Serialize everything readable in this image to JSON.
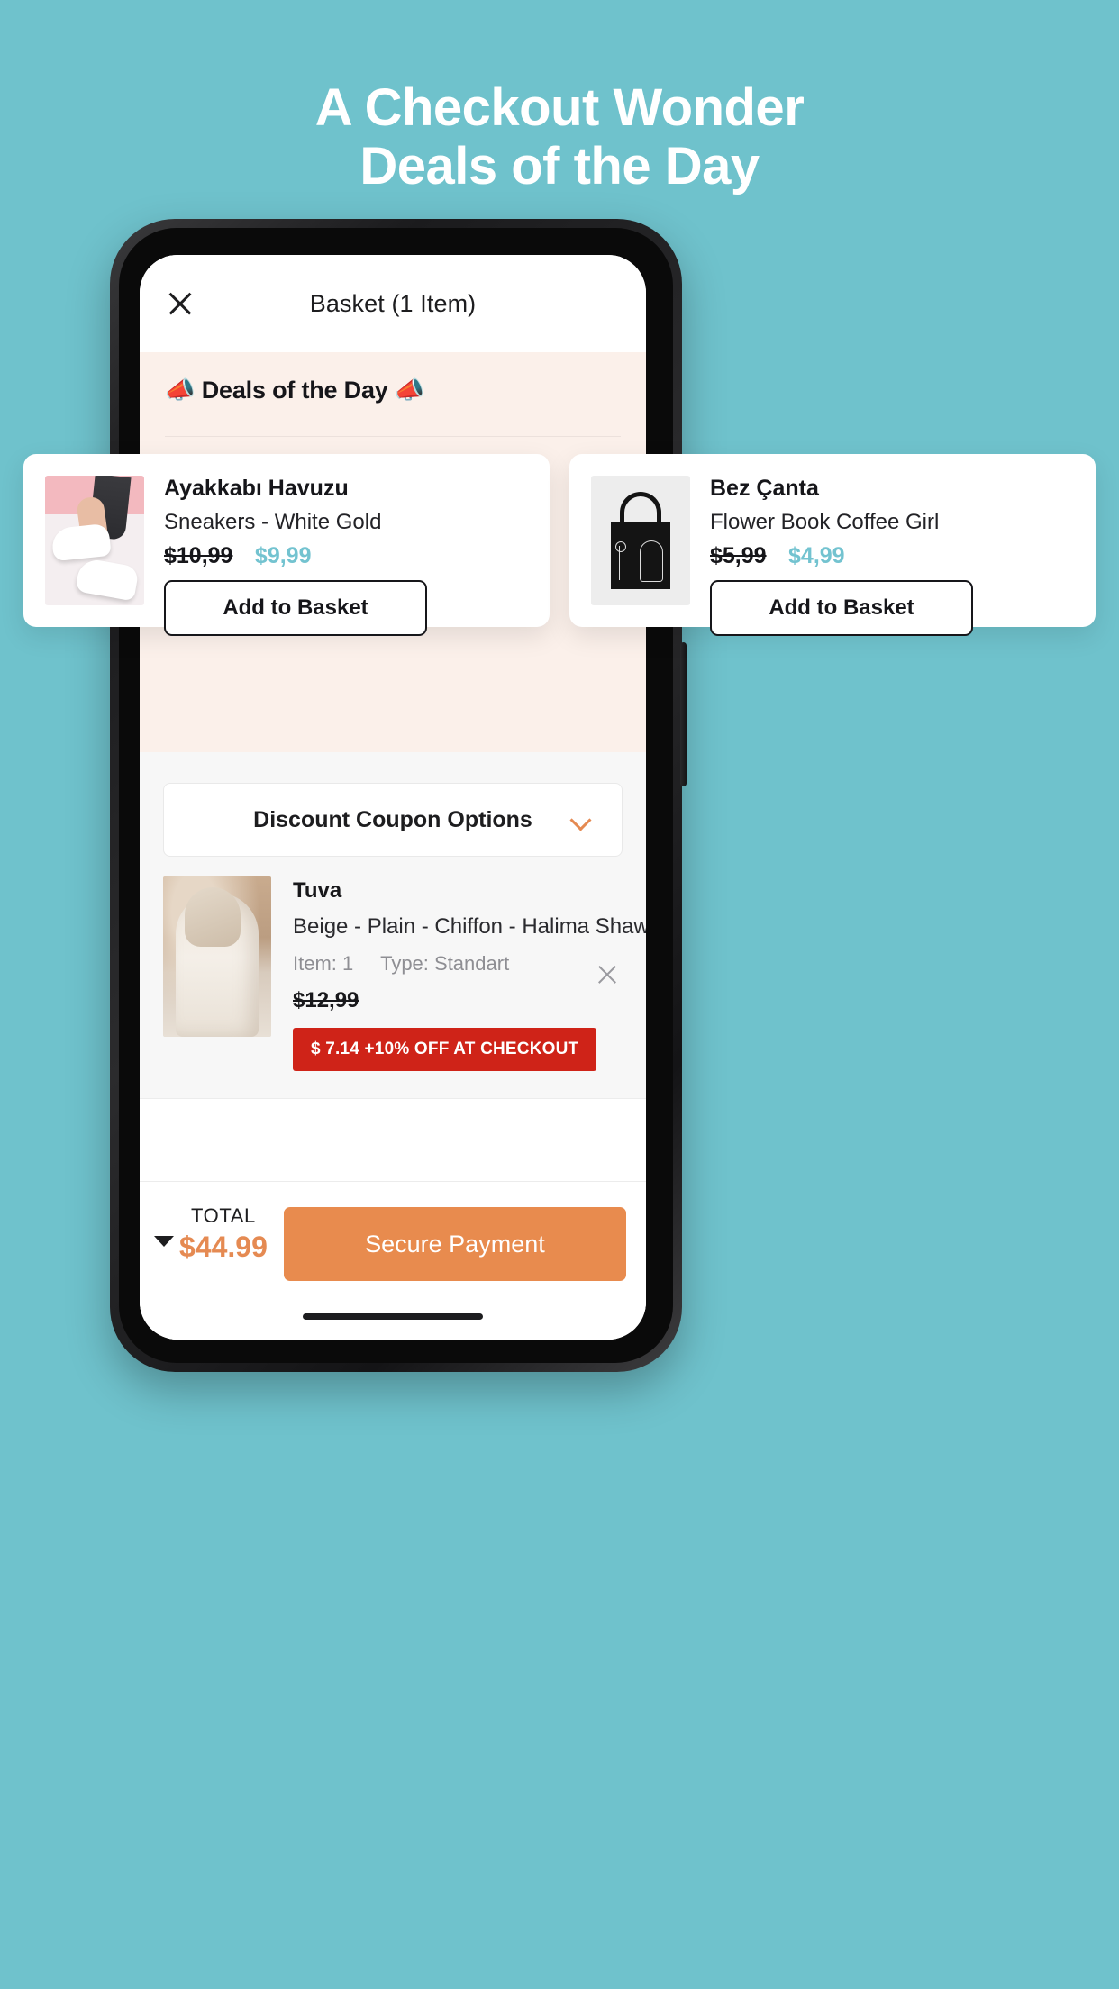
{
  "headline": {
    "line1": "A Checkout Wonder",
    "line2": "Deals of the Day"
  },
  "colors": {
    "background": "#6fc2cc",
    "accent_teal": "#73c3d0",
    "accent_orange": "#e88b4e",
    "discount_red": "#cf2318",
    "banner_peach": "#fbf0ea"
  },
  "app": {
    "header": {
      "close_icon": "close-icon",
      "title": "Basket (1 Item)"
    },
    "deals_banner": {
      "left_emoji": "📣",
      "title": "Deals of the Day",
      "right_emoji": "📣"
    },
    "promo_products": [
      {
        "brand": "Ayakkabı Havuzu",
        "name": "Sneakers - White Gold",
        "old_price": "$10,99",
        "new_price": "$9,99",
        "button_label": "Add to Basket",
        "image": "sneakers-photo"
      },
      {
        "brand": "Bez Çanta",
        "name": "Flower Book Coffee Girl",
        "old_price": "$5,99",
        "new_price": "$4,99",
        "button_label": "Add to Basket",
        "image": "tote-bag-photo"
      }
    ],
    "coupon": {
      "label": "Discount Coupon Options",
      "chevron_icon": "chevron-down-icon"
    },
    "basket_item": {
      "brand": "Tuva",
      "description": "Beige - Plain - Chiffon - Halima Shawl…",
      "quantity_label": "Item: 1",
      "type_label": "Type: Standart",
      "old_price": "$12,99",
      "discount_badge": "$ 7.14 +10% OFF AT CHECKOUT",
      "remove_icon": "close-icon",
      "image": "hijab-model-photo"
    },
    "bottom_bar": {
      "caret_icon": "caret-up-icon",
      "total_label": "TOTAL",
      "total_value": "$44.99",
      "pay_button_label": "Secure Payment"
    }
  }
}
